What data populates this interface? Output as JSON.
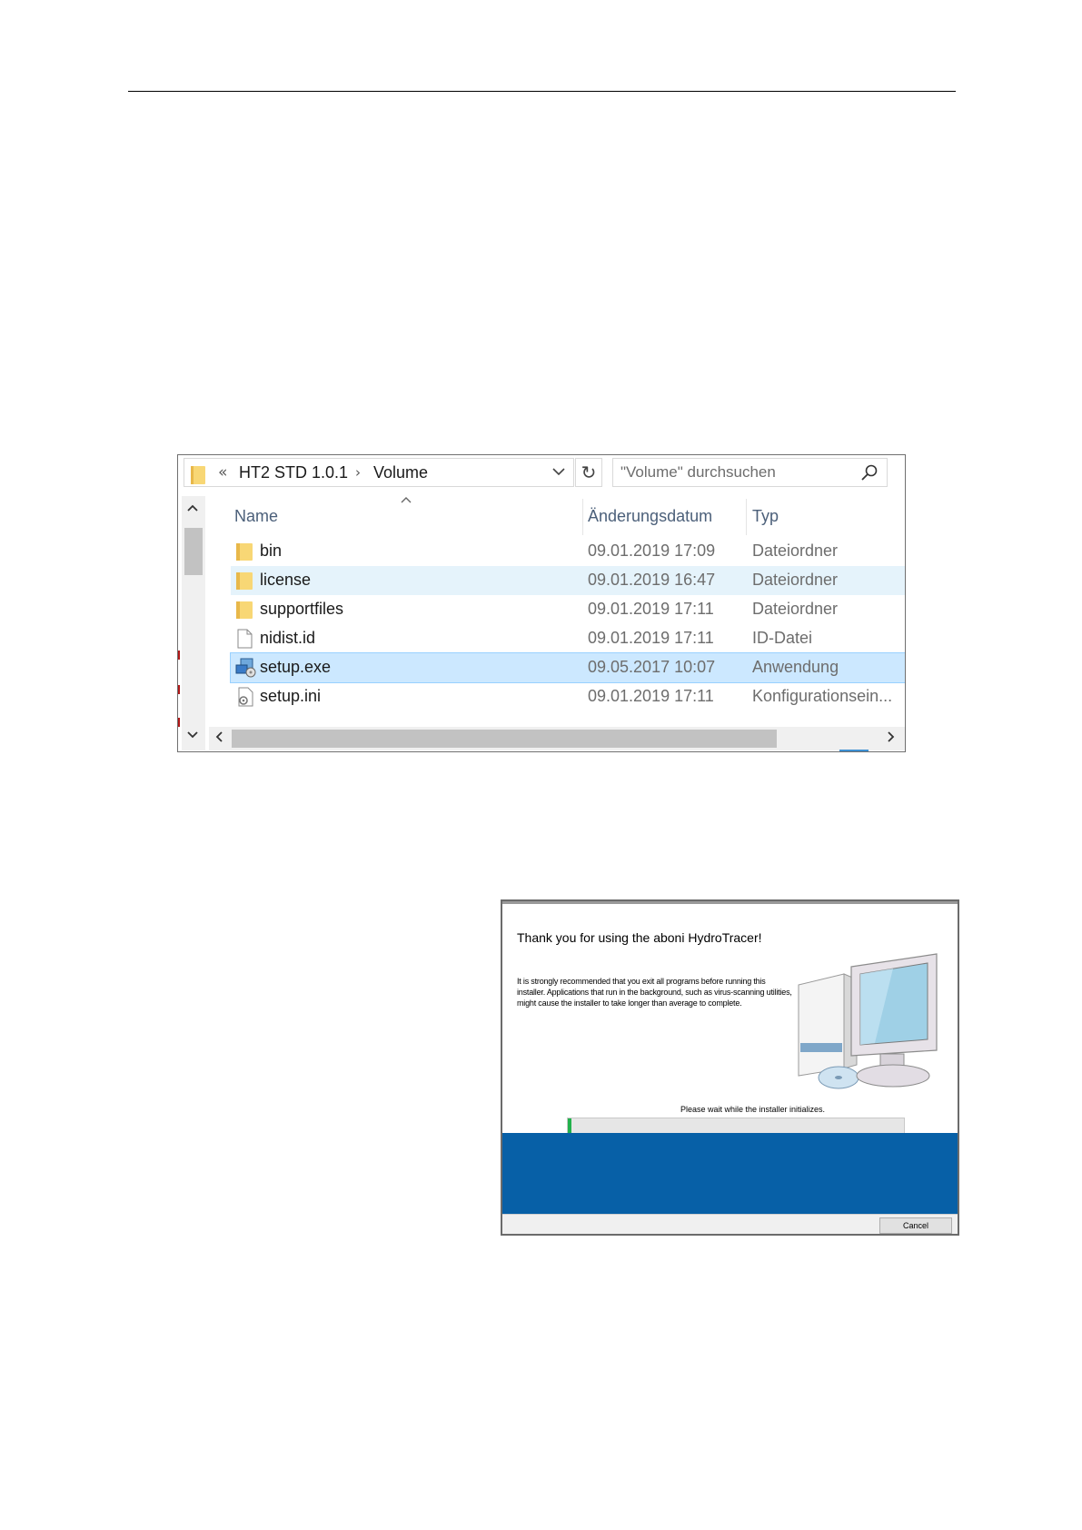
{
  "explorer": {
    "breadcrumb": {
      "overflow_glyph": "«",
      "items": [
        "HT2 STD 1.0.1",
        "Volume"
      ],
      "separator": "›",
      "dropdown_glyph": "⌄"
    },
    "refresh_glyph": "↻",
    "search": {
      "placeholder": "\"Volume\" durchsuchen"
    },
    "columns": {
      "name": "Name",
      "date": "Änderungsdatum",
      "type": "Typ"
    },
    "files": [
      {
        "name": "bin",
        "date": "09.01.2019 17:09",
        "type": "Dateiordner",
        "icon": "folder-icon",
        "state": "normal"
      },
      {
        "name": "license",
        "date": "09.01.2019 16:47",
        "type": "Dateiordner",
        "icon": "folder-icon",
        "state": "hover"
      },
      {
        "name": "supportfiles",
        "date": "09.01.2019 17:11",
        "type": "Dateiordner",
        "icon": "folder-icon",
        "state": "normal"
      },
      {
        "name": "nidist.id",
        "date": "09.01.2019 17:11",
        "type": "ID-Datei",
        "icon": "file-icon",
        "state": "normal"
      },
      {
        "name": "setup.exe",
        "date": "09.05.2017 10:07",
        "type": "Anwendung",
        "icon": "installer-icon",
        "state": "selected"
      },
      {
        "name": "setup.ini",
        "date": "09.01.2019 17:11",
        "type": "Konfigurationsein...",
        "icon": "config-file-icon",
        "state": "normal"
      }
    ]
  },
  "installer": {
    "title": "Thank you for using the aboni HydroTracer!",
    "body": "It is strongly recommended that you exit all programs before running this installer. Applications that run in the background, such as virus-scanning utilities, might cause the installer to take longer than average to complete.",
    "status": "Please wait while the installer initializes.",
    "progress_fraction": 0.01,
    "cancel_label": "Cancel",
    "colors": {
      "banner": "#0760a7",
      "progress": "#22b14c"
    }
  }
}
